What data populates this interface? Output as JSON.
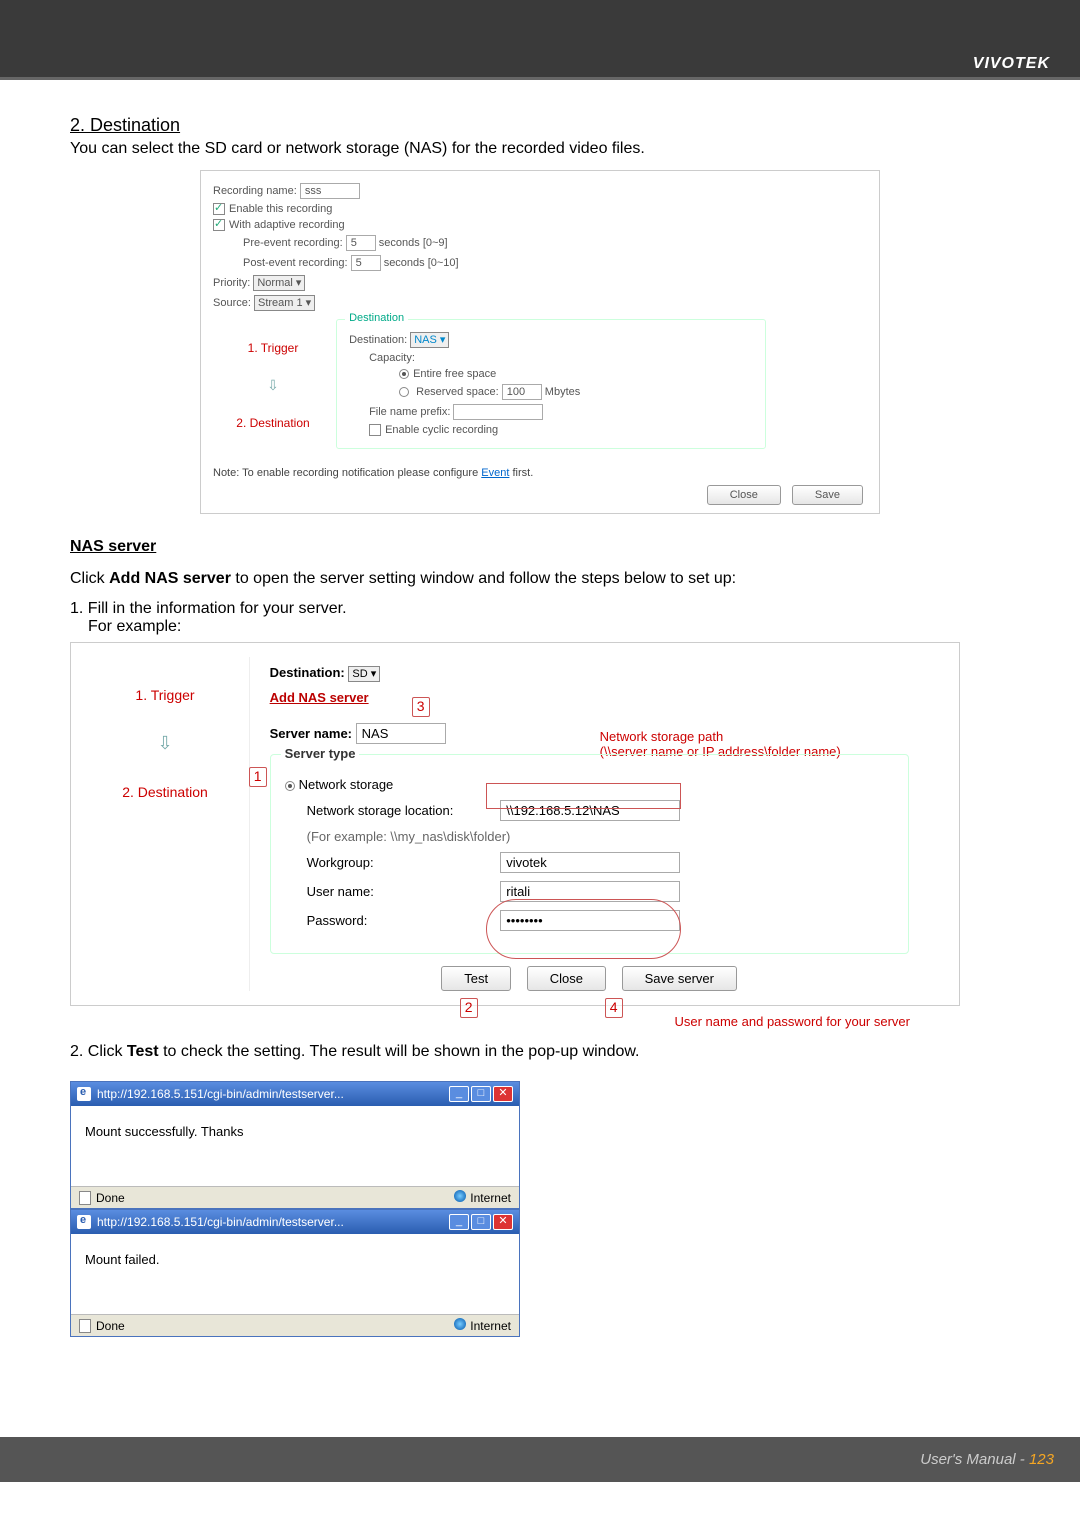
{
  "brand": "VIVOTEK",
  "section": {
    "title": "2. Destination",
    "intro": "You can select the SD card or network storage (NAS) for the recorded video files."
  },
  "panel1": {
    "recording_name_label": "Recording name:",
    "recording_name": "sss",
    "enable": "Enable this recording",
    "adaptive": "With adaptive recording",
    "pre_label": "Pre-event recording:",
    "pre_value": "5",
    "pre_hint": "seconds [0~9]",
    "post_label": "Post-event recording:",
    "post_value": "5",
    "post_hint": "seconds [0~10]",
    "priority_label": "Priority:",
    "priority": "Normal",
    "source_label": "Source:",
    "source": "Stream 1",
    "steps": {
      "s1": "1. Trigger",
      "s2": "2. Destination"
    },
    "dest": {
      "legend": "Destination",
      "label": "Destination:",
      "value": "NAS",
      "capacity": "Capacity:",
      "entire": "Entire free space",
      "reserved": "Reserved space:",
      "reserved_val": "100",
      "mbytes": "Mbytes",
      "prefix": "File name prefix:",
      "cyclic": "Enable cyclic recording"
    },
    "note": "Note: To enable recording notification please configure",
    "note_link": "Event",
    "note_after": "first.",
    "close": "Close",
    "save": "Save"
  },
  "nas_heading": "NAS server",
  "nas_text_pre": "Click ",
  "nas_text_bold": "Add NAS server",
  "nas_text_post": " to open the server setting window and follow the steps below to set up:",
  "nas_step1": "1. Fill in the information for your server.",
  "nas_example": "For example:",
  "panel2": {
    "steps": {
      "s1": "1. Trigger",
      "s2": "2. Destination"
    },
    "dest_label": "Destination:",
    "dest_value": "SD",
    "add_nas": "Add NAS server",
    "server_name_label": "Server name:",
    "server_name": "NAS",
    "server_type": "Server type",
    "networkstorage": "Network storage",
    "nslabel": "Network storage location:",
    "nsvalue": "\\\\192.168.5.12\\NAS",
    "nshint": "(For example: \\\\my_nas\\disk\\folder)",
    "wg_label": "Workgroup:",
    "wg": "vivotek",
    "user_label": "User name:",
    "user": "ritali",
    "pw_label": "Password:",
    "pw": "••••••••",
    "test": "Test",
    "close": "Close",
    "save": "Save server",
    "ann_path": "Network storage path",
    "ann_path2": "(\\\\server name or IP address\\folder name)",
    "ann_user": "User name and password for your server",
    "m1": "1",
    "m2": "2",
    "m3": "3",
    "m4": "4"
  },
  "test_line_pre": "2. Click ",
  "test_bold": "Test",
  "test_line_post": " to check the setting. The result will be shown in the pop-up window.",
  "popup": {
    "url": "http://192.168.5.151/cgi-bin/admin/testserver...",
    "ok": "Mount successfully. Thanks",
    "fail": "Mount failed.",
    "done": "Done",
    "internet": "Internet"
  },
  "footer": {
    "label": "User's Manual - ",
    "page": "123"
  }
}
